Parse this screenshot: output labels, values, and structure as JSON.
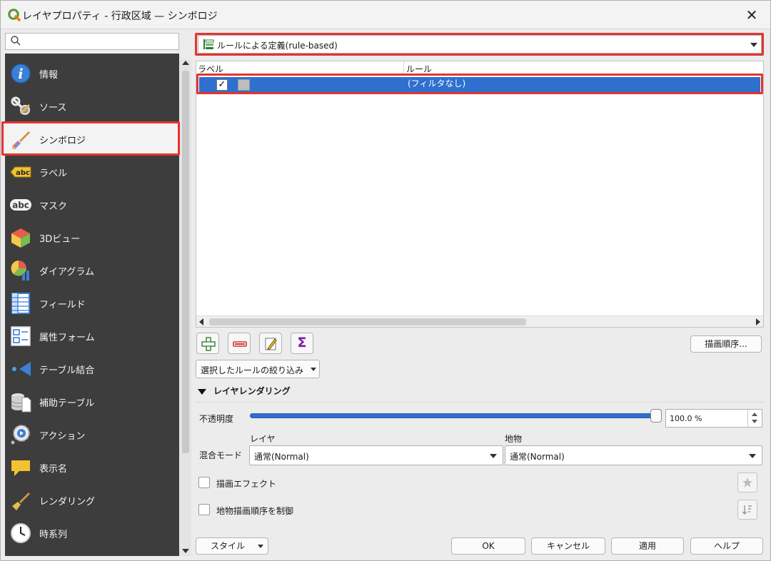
{
  "window": {
    "title": "レイヤプロパティ - 行政区域 — シンボロジ",
    "close_glyph": "✕"
  },
  "search": {
    "placeholder": "",
    "value": ""
  },
  "sidebar": {
    "items": [
      {
        "label": "情報",
        "icon": "info-icon"
      },
      {
        "label": "ソース",
        "icon": "source-icon"
      },
      {
        "label": "シンボロジ",
        "icon": "symbology-icon",
        "selected": true
      },
      {
        "label": "ラベル",
        "icon": "labels-icon"
      },
      {
        "label": "マスク",
        "icon": "mask-icon"
      },
      {
        "label": "3Dビュー",
        "icon": "3d-view-icon"
      },
      {
        "label": "ダイアグラム",
        "icon": "diagram-icon"
      },
      {
        "label": "フィールド",
        "icon": "fields-icon"
      },
      {
        "label": "属性フォーム",
        "icon": "attribute-form-icon"
      },
      {
        "label": "テーブル結合",
        "icon": "joins-icon"
      },
      {
        "label": "補助テーブル",
        "icon": "auxiliary-storage-icon"
      },
      {
        "label": "アクション",
        "icon": "actions-icon"
      },
      {
        "label": "表示名",
        "icon": "display-icon"
      },
      {
        "label": "レンダリング",
        "icon": "rendering-icon"
      },
      {
        "label": "時系列",
        "icon": "temporal-icon"
      }
    ],
    "icon_badges": {
      "labels": "abc",
      "mask": "abc"
    }
  },
  "renderer": {
    "label": "ルールによる定義(rule-based)",
    "icon": "rule-based-renderer-icon"
  },
  "rules_tree": {
    "columns": [
      "ラベル",
      "ルール"
    ],
    "rows": [
      {
        "checked": true,
        "check_glyph": "✓",
        "label": "",
        "rule": "(フィルタなし)"
      }
    ]
  },
  "toolbar": {
    "add_rule": "add-rule-icon",
    "remove_rule": "remove-rule-icon",
    "edit_rule": "edit-rule-icon",
    "sigma": "Σ",
    "render_order_label": "描画順序..."
  },
  "filter_dropdown": {
    "label": "選択したルールの絞り込み"
  },
  "layer_rendering": {
    "title": "レイヤレンダリング",
    "opacity_label": "不透明度",
    "opacity_value": "100.0 %",
    "opacity_fraction": 1.0,
    "blend_label": "混合モード",
    "layer_label": "レイヤ",
    "feature_label": "地物",
    "layer_blend_value": "通常(Normal)",
    "feature_blend_value": "通常(Normal)",
    "draw_effects_label": "描画エフェクト",
    "control_order_label": "地物描画順序を制御"
  },
  "buttons": {
    "style": "スタイル",
    "ok": "OK",
    "cancel": "キャンセル",
    "apply": "適用",
    "help": "ヘルプ"
  },
  "colors": {
    "accent": "#2f6fce",
    "highlight_frame": "#e3342f",
    "sidebar_bg": "#3d3d3d"
  }
}
